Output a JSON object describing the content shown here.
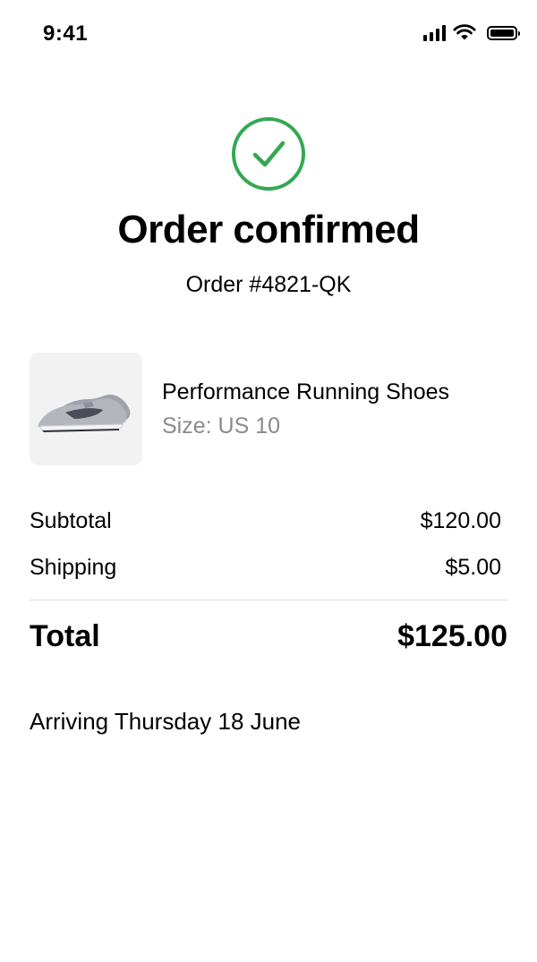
{
  "status_bar": {
    "time": "9:41"
  },
  "icons": {
    "signal": "signal-icon",
    "wifi": "wifi-icon",
    "battery": "battery-icon",
    "success": "checkmark-circle-icon",
    "product_image": "running-shoe-image"
  },
  "colors": {
    "success": "#34a853",
    "muted_text": "#8a8a8e",
    "thumb_bg": "#f2f2f2"
  },
  "confirmation": {
    "title": "Order confirmed",
    "order_number": "Order #4821-QK"
  },
  "product": {
    "name": "Performance Running Shoes",
    "size": "Size: US 10"
  },
  "summary": {
    "subtotal_label": "Subtotal",
    "subtotal_value": "$120.00",
    "shipping_label": "Shipping",
    "shipping_value": "$5.00",
    "total_label": "Total",
    "total_value": "$125.00"
  },
  "delivery": {
    "arrival_text": "Arriving Thursday 18 June"
  }
}
